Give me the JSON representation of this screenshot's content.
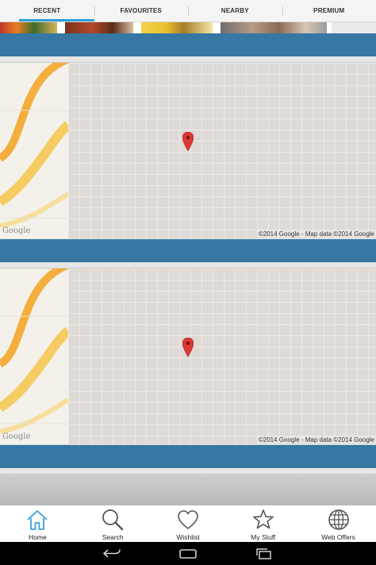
{
  "tabs": [
    {
      "label": "RECENT",
      "active": true
    },
    {
      "label": "FAVOURITES",
      "active": false
    },
    {
      "label": "NEARBY",
      "active": false
    },
    {
      "label": "PREMIUM",
      "active": false
    }
  ],
  "maps": [
    {
      "logo": "Google",
      "copyright": "©2014 Google - Map data ©2014 Google",
      "marker": "map-pin-icon"
    },
    {
      "logo": "Google",
      "copyright": "©2014 Google - Map data ©2014 Google",
      "marker": "map-pin-icon"
    }
  ],
  "bottom_nav": [
    {
      "label": "Home",
      "icon": "home-icon"
    },
    {
      "label": "Search",
      "icon": "search-icon"
    },
    {
      "label": "Wishlist",
      "icon": "heart-icon"
    },
    {
      "label": "My Stuff",
      "icon": "star-icon"
    },
    {
      "label": "Web Offers",
      "icon": "globe-icon"
    }
  ],
  "colors": {
    "accent": "#2f9fd6",
    "section_bar": "#3677a4",
    "map_bg": "#dfdad6",
    "pin": "#d93a36"
  }
}
